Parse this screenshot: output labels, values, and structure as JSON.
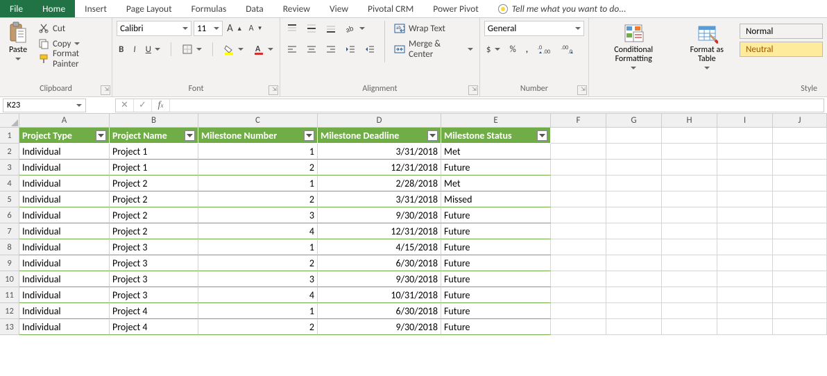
{
  "tabs": {
    "file": "File",
    "home": "Home",
    "insert": "Insert",
    "page_layout": "Page Layout",
    "formulas": "Formulas",
    "data": "Data",
    "review": "Review",
    "view": "View",
    "pivotal": "Pivotal CRM",
    "power_pivot": "Power Pivot",
    "tell_me": "Tell me what you want to do..."
  },
  "ribbon": {
    "clipboard": {
      "label": "Clipboard",
      "paste": "Paste",
      "cut": "Cut",
      "copy": "Copy",
      "format_painter": "Format Painter"
    },
    "font": {
      "label": "Font",
      "name": "Calibri",
      "size": "11"
    },
    "alignment": {
      "label": "Alignment",
      "wrap": "Wrap Text",
      "merge": "Merge & Center"
    },
    "number": {
      "label": "Number",
      "format": "General"
    },
    "styles": {
      "label": "Style",
      "cond_fmt": "Conditional Formatting",
      "fmt_table": "Format as Table",
      "normal": "Normal",
      "neutral": "Neutral"
    }
  },
  "namebox": "K23",
  "formula": "",
  "columns": [
    "A",
    "B",
    "C",
    "D",
    "E",
    "F",
    "G",
    "H",
    "I",
    "J"
  ],
  "row_numbers": [
    1,
    2,
    3,
    4,
    5,
    6,
    7,
    8,
    9,
    10,
    11,
    12,
    13
  ],
  "table": {
    "headers": [
      "Project Type",
      "Project Name",
      "Milestone Number",
      "Milestone Deadline",
      "Milestone Status"
    ],
    "rows": [
      [
        "Individual",
        "Project 1",
        "1",
        "3/31/2018",
        "Met"
      ],
      [
        "Individual",
        "Project 1",
        "2",
        "12/31/2018",
        "Future"
      ],
      [
        "Individual",
        "Project 2",
        "1",
        "2/28/2018",
        "Met"
      ],
      [
        "Individual",
        "Project 2",
        "2",
        "3/31/2018",
        "Missed"
      ],
      [
        "Individual",
        "Project 2",
        "3",
        "9/30/2018",
        "Future"
      ],
      [
        "Individual",
        "Project 2",
        "4",
        "12/31/2018",
        "Future"
      ],
      [
        "Individual",
        "Project 3",
        "1",
        "4/15/2018",
        "Future"
      ],
      [
        "Individual",
        "Project 3",
        "2",
        "6/30/2018",
        "Future"
      ],
      [
        "Individual",
        "Project 3",
        "3",
        "9/30/2018",
        "Future"
      ],
      [
        "Individual",
        "Project 3",
        "4",
        "10/31/2018",
        "Future"
      ],
      [
        "Individual",
        "Project 4",
        "1",
        "6/30/2018",
        "Future"
      ],
      [
        "Individual",
        "Project 4",
        "2",
        "9/30/2018",
        "Future"
      ]
    ]
  }
}
